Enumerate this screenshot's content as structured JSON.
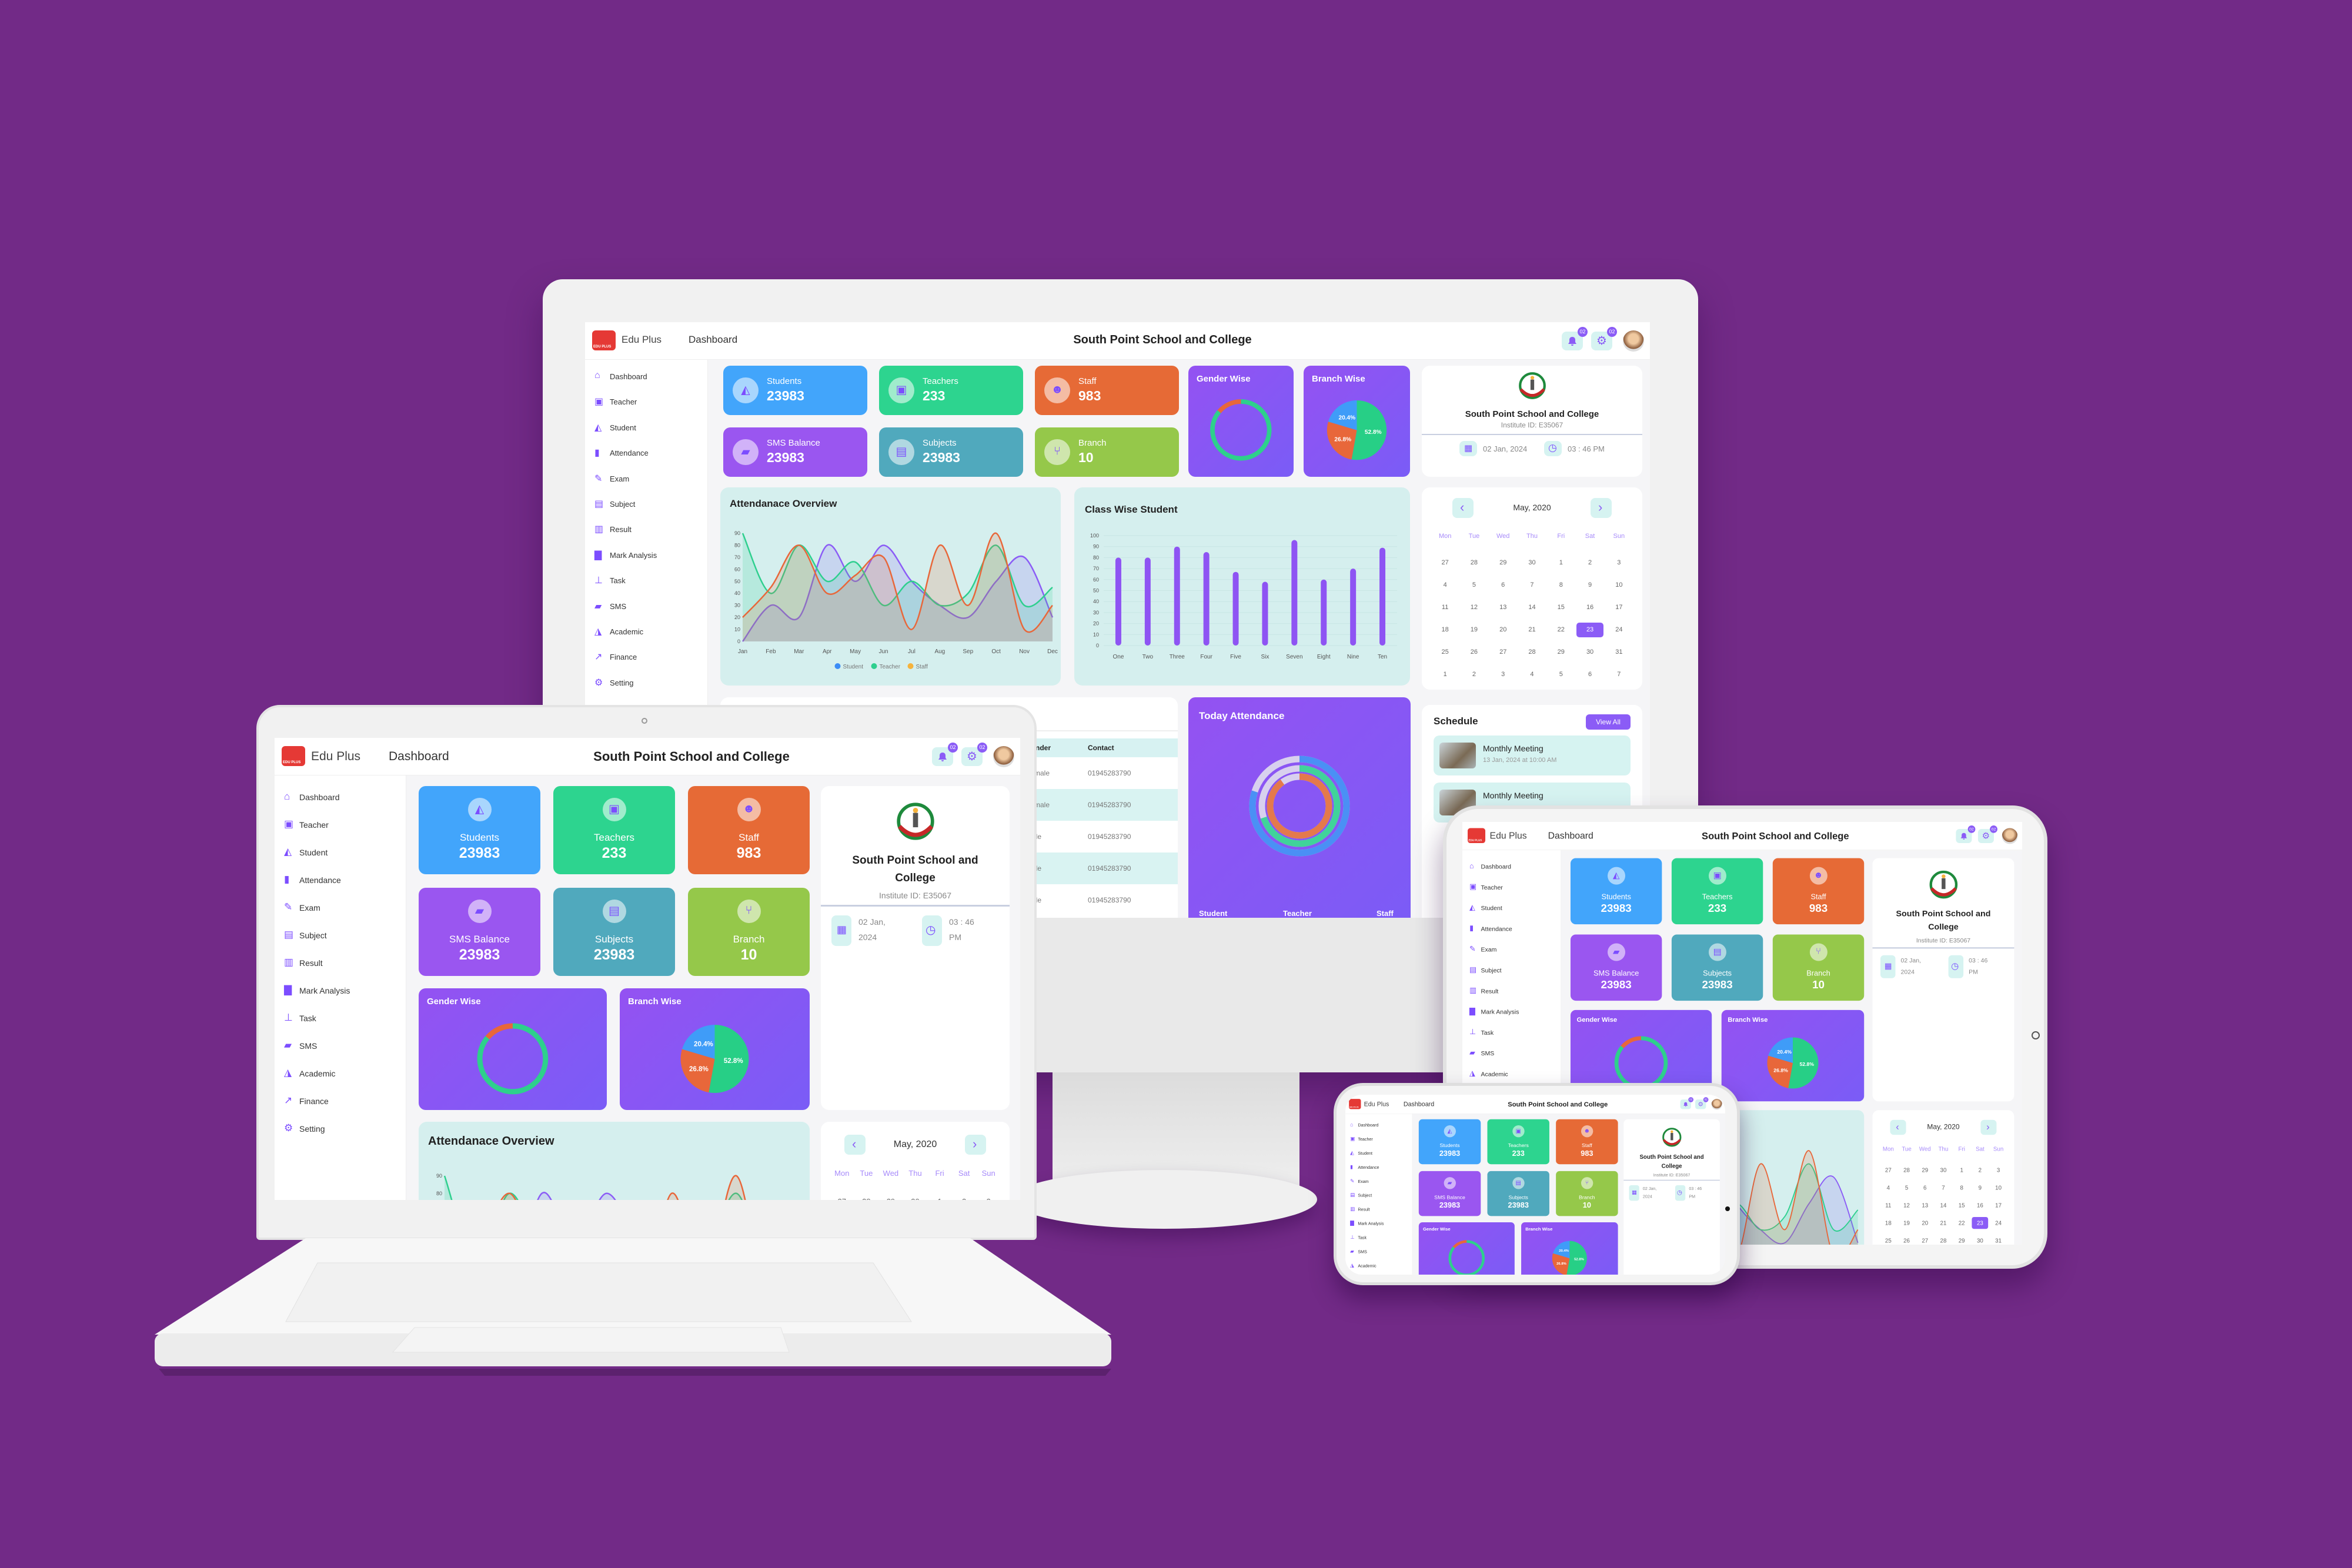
{
  "colors": {
    "background": "#722a87",
    "accent": "#8b5cf6",
    "students": "#42a5fb",
    "teachers": "#2dd48f",
    "staff": "#e66a36",
    "sms": "#9a56f0",
    "subjects": "#50a9bd",
    "branch": "#95c84a",
    "panel_teal": "#d5efee"
  },
  "header": {
    "logo_text": "EDU PLUS",
    "app_name": "Edu Plus",
    "page": "Dashboard",
    "title": "South Point School and College",
    "notifications_badge": "02",
    "settings_badge": "02"
  },
  "sidebar": {
    "items": [
      {
        "label": "Dashboard",
        "icon": "home-icon"
      },
      {
        "label": "Teacher",
        "icon": "teacher-icon"
      },
      {
        "label": "Student",
        "icon": "graduation-cap-icon"
      },
      {
        "label": "Attendance",
        "icon": "clipboard-icon"
      },
      {
        "label": "Exam",
        "icon": "exam-icon"
      },
      {
        "label": "Subject",
        "icon": "book-icon"
      },
      {
        "label": "Result",
        "icon": "result-icon"
      },
      {
        "label": "Mark Analysis",
        "icon": "bar-chart-icon"
      },
      {
        "label": "Task",
        "icon": "pin-icon"
      },
      {
        "label": "SMS",
        "icon": "message-icon"
      },
      {
        "label": "Academic",
        "icon": "academic-icon"
      },
      {
        "label": "Finance",
        "icon": "line-chart-icon"
      },
      {
        "label": "Setting",
        "icon": "gear-icon"
      }
    ]
  },
  "stats": [
    {
      "label": "Students",
      "value": "23983",
      "icon": "graduation-cap-icon",
      "color": "#42a5fb"
    },
    {
      "label": "Teachers",
      "value": "233",
      "icon": "teacher-icon",
      "color": "#2dd48f"
    },
    {
      "label": "Staff",
      "value": "983",
      "icon": "users-icon",
      "color": "#e66a36"
    },
    {
      "label": "SMS Balance",
      "value": "23983",
      "icon": "message-icon",
      "color": "#9a56f0"
    },
    {
      "label": "Subjects",
      "value": "23983",
      "icon": "book-icon",
      "color": "#50a9bd"
    },
    {
      "label": "Branch",
      "value": "10",
      "icon": "branch-icon",
      "color": "#95c84a"
    }
  ],
  "institute": {
    "name": "South Point School and College",
    "id_label": "Institute ID: E35067",
    "date": "02 Jan, 2024",
    "time": "03 : 46 PM"
  },
  "calendar": {
    "month": "May, 2020",
    "prev": "‹",
    "next": "›",
    "weekdays": [
      "Mon",
      "Tue",
      "Wed",
      "Thu",
      "Fri",
      "Sat",
      "Sun"
    ],
    "weeks": [
      [
        "27",
        "28",
        "29",
        "30",
        "1",
        "2",
        "3"
      ],
      [
        "4",
        "5",
        "6",
        "7",
        "8",
        "9",
        "10"
      ],
      [
        "11",
        "12",
        "13",
        "14",
        "15",
        "16",
        "17"
      ],
      [
        "18",
        "19",
        "20",
        "21",
        "22",
        "23",
        "24"
      ],
      [
        "25",
        "26",
        "27",
        "28",
        "29",
        "30",
        "31"
      ],
      [
        "1",
        "2",
        "3",
        "4",
        "5",
        "6",
        "7"
      ]
    ],
    "selected": "23"
  },
  "table": {
    "columns": [
      "Gender",
      "Contact"
    ],
    "rows": [
      [
        "Female",
        "01945283790"
      ],
      [
        "Female",
        "01945283790"
      ],
      [
        "Male",
        "01945283790"
      ],
      [
        "Male",
        "01945283790"
      ],
      [
        "Male",
        "01945283790"
      ]
    ]
  },
  "schedule": {
    "title": "Schedule",
    "view_all": "View All",
    "items": [
      {
        "title": "Monthly Meeting",
        "when": "13 Jan, 2024 at 10:00 AM"
      },
      {
        "title": "Monthly Meeting",
        "when": ""
      }
    ]
  },
  "chart_data": [
    {
      "id": "attendance",
      "type": "area",
      "title": "Attendanace Overview",
      "categories": [
        "Jan",
        "Feb",
        "Mar",
        "Apr",
        "May",
        "Jun",
        "Jul",
        "Aug",
        "Sep",
        "Oct",
        "Nov",
        "Dec"
      ],
      "ylim": [
        0,
        90
      ],
      "yticks": [
        0,
        10,
        20,
        30,
        40,
        50,
        60,
        70,
        80,
        90
      ],
      "legend": "bottom",
      "series": [
        {
          "name": "Student",
          "color": "#8b5cf6",
          "legend_color": "#3b8cf6",
          "values": [
            0,
            30,
            20,
            80,
            50,
            80,
            50,
            30,
            20,
            50,
            70,
            20
          ]
        },
        {
          "name": "Teacher",
          "color": "#2ecf8e",
          "legend_color": "#2ecf8e",
          "values": [
            90,
            40,
            80,
            50,
            66,
            30,
            50,
            30,
            40,
            80,
            30,
            45
          ]
        },
        {
          "name": "Staff",
          "color": "#e8673a",
          "legend_color": "#f6b33c",
          "values": [
            20,
            45,
            80,
            40,
            55,
            70,
            10,
            80,
            30,
            90,
            10,
            30
          ]
        }
      ]
    },
    {
      "id": "class_wise",
      "type": "bar",
      "title": "Class Wise Student",
      "categories": [
        "One",
        "Two",
        "Three",
        "Four",
        "Five",
        "Six",
        "Seven",
        "Eight",
        "Nine",
        "Ten"
      ],
      "values": [
        80,
        80,
        90,
        85,
        67,
        58,
        96,
        60,
        70,
        89
      ],
      "ylim": [
        0,
        100
      ],
      "yticks": [
        0,
        10,
        20,
        30,
        40,
        50,
        60,
        70,
        80,
        90,
        100
      ],
      "color": "#8e54f3"
    },
    {
      "id": "gender_wise",
      "type": "pie",
      "title": "Gender Wise",
      "donut": true,
      "values": [
        86,
        14
      ],
      "colors": [
        "#2ed08c",
        "#e8673a"
      ]
    },
    {
      "id": "branch_wise",
      "type": "pie",
      "title": "Branch Wise",
      "values": [
        52.8,
        26.8,
        20.4
      ],
      "labels": [
        "52.8%",
        "26.8%",
        "20.4%"
      ],
      "colors": [
        "#27cf86",
        "#e8673a",
        "#3f9cf8"
      ]
    },
    {
      "id": "today_attendance",
      "type": "pie",
      "title": "Today Attendance",
      "categories": [
        "Student",
        "Teacher",
        "Staff"
      ],
      "values": [
        80,
        70,
        90
      ],
      "labels": [
        "80%",
        "70%",
        "90%"
      ],
      "colors": [
        "#4a90f5",
        "#40d39a",
        "#e4794c"
      ]
    }
  ]
}
